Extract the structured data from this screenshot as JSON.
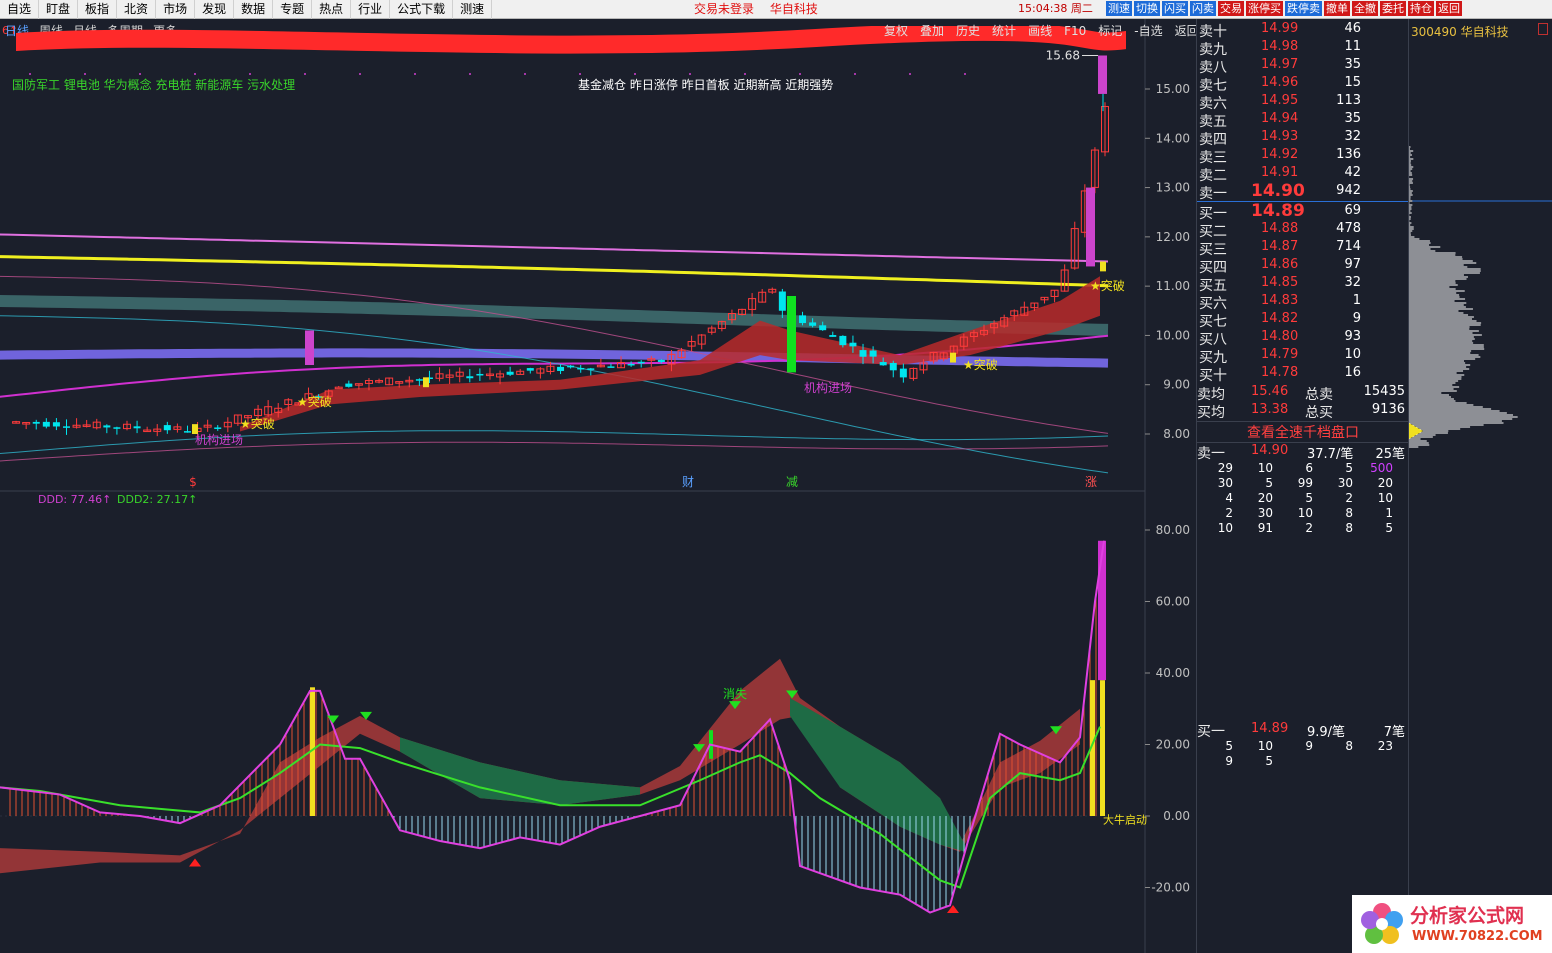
{
  "menu": [
    "自选",
    "盯盘",
    "板指",
    "北资",
    "市场",
    "发现",
    "数据",
    "专题",
    "热点",
    "行业",
    "公式下载",
    "测速"
  ],
  "status": {
    "trade_login": "交易未登录",
    "stock_name_top": "华自科技",
    "clock": "15:04:38 周二"
  },
  "tools": [
    {
      "label": "测速",
      "color": "blue"
    },
    {
      "label": "切换",
      "color": "blue"
    },
    {
      "label": "闪买",
      "color": "blue"
    },
    {
      "label": "闪卖",
      "color": "blue"
    },
    {
      "label": "交易",
      "color": "red"
    },
    {
      "label": "涨停买",
      "color": "red"
    },
    {
      "label": "跌停卖",
      "color": "blue"
    },
    {
      "label": "撤单",
      "color": "red"
    },
    {
      "label": "全撤",
      "color": "red"
    },
    {
      "label": "委托",
      "color": "red"
    },
    {
      "label": "持仓",
      "color": "red"
    },
    {
      "label": "返回",
      "color": "red"
    }
  ],
  "period_tabs": [
    "日线",
    "周线",
    "月线",
    "多周期",
    "更多"
  ],
  "right_tabs": [
    "复权",
    "叠加",
    "历史",
    "统计",
    "画线",
    "F10",
    "标记",
    "-自选",
    "返回"
  ],
  "concepts": "国防军工 锂电池 华为概念 充电桩 新能源车 污水处理",
  "tags": "基金减仓 昨日涨停 昨日首板 近期新高 近期强势",
  "main_chart": {
    "y_ticks": [
      "15.00",
      "14.00",
      "13.00",
      "12.00",
      "11.00",
      "10.00",
      "9.00",
      "8.00"
    ],
    "y_tick_values": [
      15,
      14,
      13,
      12,
      11,
      10,
      9,
      8
    ],
    "high_label": "15.68",
    "annotations": [
      {
        "text": "★突破",
        "price": 8.2
      },
      {
        "text": "★突破",
        "price": 8.65
      },
      {
        "text": "★突破",
        "price": 9.4
      },
      {
        "text": "★突破",
        "price": 11.0
      }
    ],
    "labels": [
      {
        "text": "机构进场"
      },
      {
        "text": "机构进场"
      }
    ],
    "markers": [
      "$",
      "财",
      "减",
      "涨"
    ],
    "corner_label": "6↑"
  },
  "indicator": {
    "legend1": "DDD: 77.46↑",
    "legend2": "DDD2: 27.17↑",
    "y_ticks": [
      "80.00",
      "60.00",
      "40.00",
      "20.00",
      "0.00",
      "-20.00"
    ],
    "y_tick_values": [
      80,
      60,
      40,
      20,
      0,
      -20
    ],
    "label_disappear": "消失",
    "label_bull": "大牛启动"
  },
  "order_book": {
    "asks": [
      {
        "label": "卖十",
        "price": "14.99",
        "vol": "46"
      },
      {
        "label": "卖九",
        "price": "14.98",
        "vol": "11"
      },
      {
        "label": "卖八",
        "price": "14.97",
        "vol": "35"
      },
      {
        "label": "卖七",
        "price": "14.96",
        "vol": "15"
      },
      {
        "label": "卖六",
        "price": "14.95",
        "vol": "113"
      },
      {
        "label": "卖五",
        "price": "14.94",
        "vol": "35"
      },
      {
        "label": "卖四",
        "price": "14.93",
        "vol": "32"
      },
      {
        "label": "卖三",
        "price": "14.92",
        "vol": "136"
      },
      {
        "label": "卖二",
        "price": "14.91",
        "vol": "42"
      },
      {
        "label": "卖一",
        "price": "14.90",
        "vol": "942"
      }
    ],
    "bids": [
      {
        "label": "买一",
        "price": "14.89",
        "vol": "69"
      },
      {
        "label": "买二",
        "price": "14.88",
        "vol": "478"
      },
      {
        "label": "买三",
        "price": "14.87",
        "vol": "714"
      },
      {
        "label": "买四",
        "price": "14.86",
        "vol": "97"
      },
      {
        "label": "买五",
        "price": "14.85",
        "vol": "32"
      },
      {
        "label": "买六",
        "price": "14.83",
        "vol": "1"
      },
      {
        "label": "买七",
        "price": "14.82",
        "vol": "9"
      },
      {
        "label": "买八",
        "price": "14.80",
        "vol": "93"
      },
      {
        "label": "买九",
        "price": "14.79",
        "vol": "10"
      },
      {
        "label": "买十",
        "price": "14.78",
        "vol": "16"
      }
    ],
    "avg_sell_label": "卖均",
    "avg_sell": "15.46",
    "total_sell_label": "总卖",
    "total_sell": "15435",
    "avg_buy_label": "买均",
    "avg_buy": "13.38",
    "total_buy_label": "总买",
    "total_buy": "9136",
    "view_all": "查看全速千档盘口",
    "ask1_queue": {
      "label": "卖一",
      "price": "14.90",
      "avg": "37.7/笔",
      "count": "25笔",
      "rows": [
        [
          "29",
          "10",
          "6",
          "5",
          "500"
        ],
        [
          "30",
          "5",
          "99",
          "30",
          "20"
        ],
        [
          "4",
          "20",
          "5",
          "2",
          "10"
        ],
        [
          "2",
          "30",
          "10",
          "8",
          "1"
        ],
        [
          "10",
          "91",
          "2",
          "8",
          "5"
        ]
      ]
    },
    "bid1_queue": {
      "label": "买一",
      "price": "14.89",
      "avg": "9.9/笔",
      "count": "7笔",
      "rows": [
        [
          "5",
          "10",
          "9",
          "8",
          "23"
        ],
        [
          "9",
          "5",
          "",
          "",
          ""
        ]
      ]
    }
  },
  "depth": {
    "title": "300490 华自科技"
  },
  "watermark": {
    "line1": "分析家公式网",
    "line2": "WWW.70822.COM"
  },
  "colors": {
    "bg": "#1b1f2b",
    "up": "#ff3b3b",
    "down": "#00e5ee",
    "grid": "#2a2f3c"
  }
}
